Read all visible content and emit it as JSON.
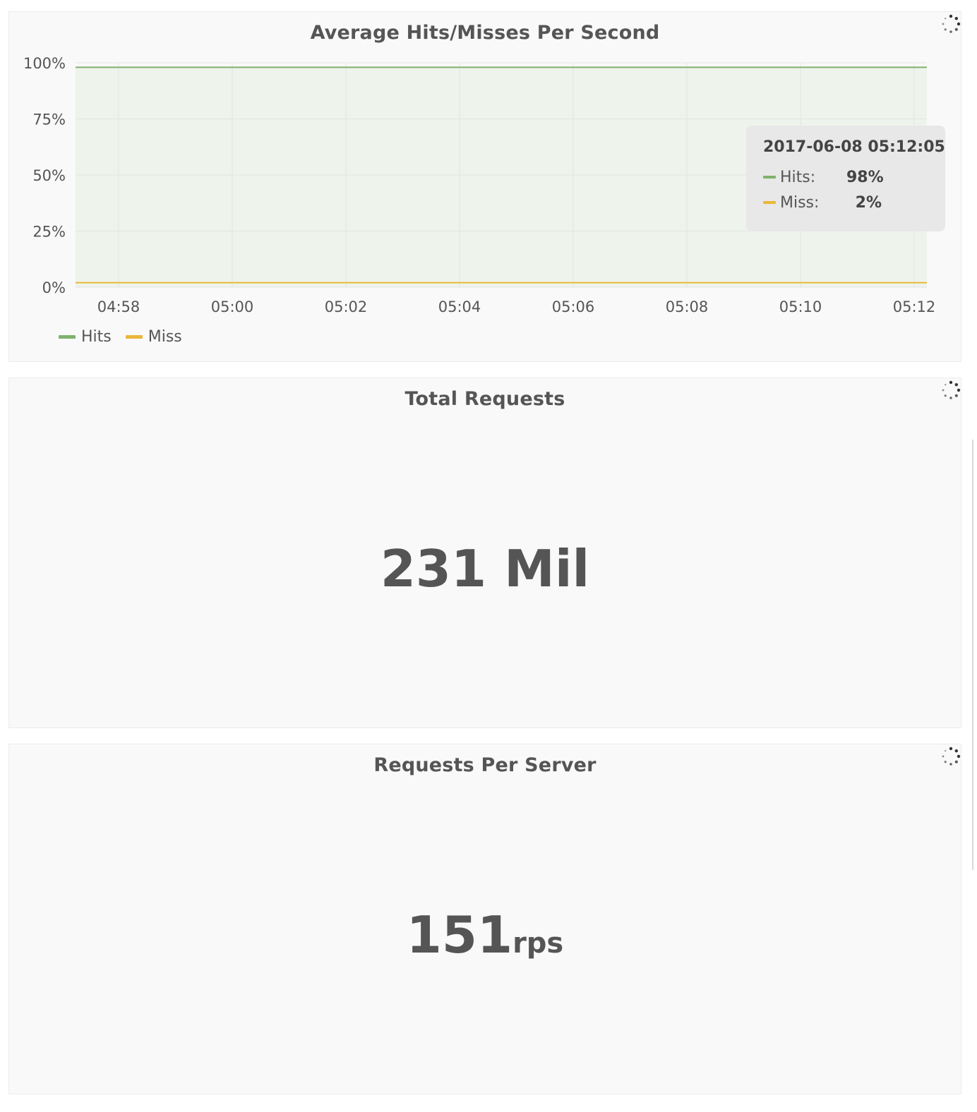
{
  "panels": {
    "hits": {
      "title": "Average Hits/Misses Per Second",
      "tooltip": {
        "time": "2017-06-08 05:12:05",
        "rows": [
          {
            "label": "Hits:",
            "value": "98%"
          },
          {
            "label": "Miss:",
            "value": "2%"
          }
        ]
      },
      "legend": [
        {
          "label": "Hits",
          "color": "#7eb26d"
        },
        {
          "label": "Miss",
          "color": "#eab839"
        }
      ]
    },
    "total": {
      "title": "Total Requests",
      "value": "231 Mil"
    },
    "rps": {
      "title": "Requests Per Server",
      "value": "151",
      "unit": "rps"
    }
  },
  "chart_data": {
    "type": "area",
    "title": "Average Hits/Misses Per Second",
    "x": [
      "04:58",
      "05:00",
      "05:02",
      "05:04",
      "05:06",
      "05:08",
      "05:10",
      "05:12"
    ],
    "x_ticks": [
      "04:58",
      "05:00",
      "05:02",
      "05:04",
      "05:06",
      "05:08",
      "05:10",
      "05:12"
    ],
    "y_ticks": [
      "0%",
      "25%",
      "50%",
      "75%",
      "100%"
    ],
    "ylim": [
      0,
      100
    ],
    "grid": true,
    "legend_position": "bottom-left",
    "series": [
      {
        "name": "Hits",
        "color": "#7eb26d",
        "values": [
          98,
          98,
          98,
          98,
          98,
          98,
          98,
          98
        ]
      },
      {
        "name": "Miss",
        "color": "#eab839",
        "values": [
          2,
          2,
          2,
          2,
          2,
          2,
          2,
          2
        ]
      }
    ]
  },
  "icons": {
    "spinner": "loading-spinner-icon"
  }
}
